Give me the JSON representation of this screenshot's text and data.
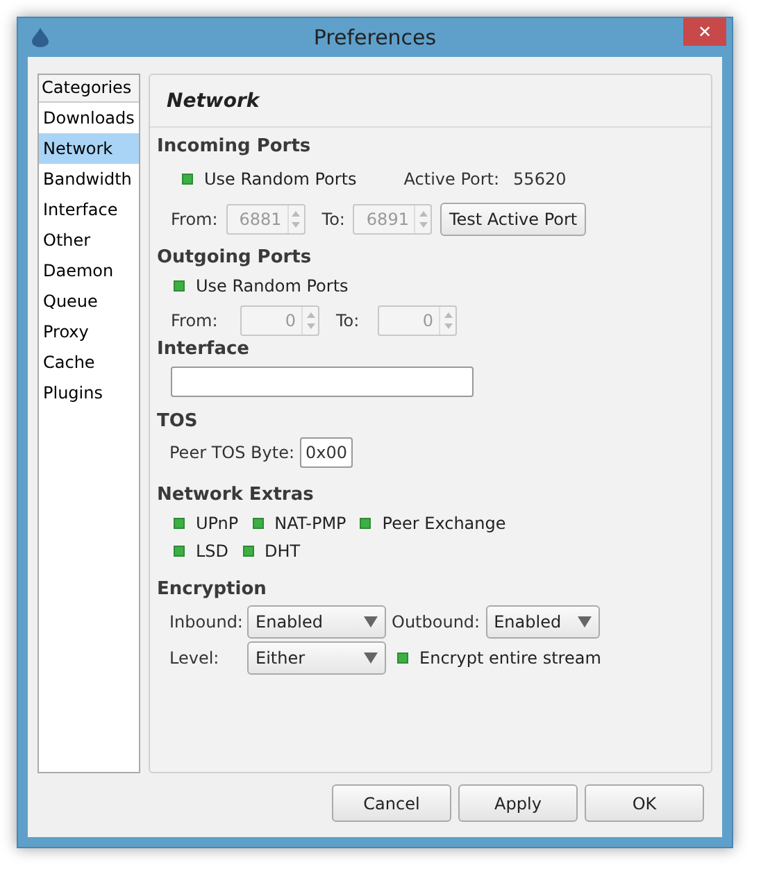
{
  "window": {
    "title": "Preferences",
    "close": "✕"
  },
  "sidebar": {
    "header": "Categories",
    "items": [
      {
        "label": "Downloads",
        "selected": false
      },
      {
        "label": "Network",
        "selected": true
      },
      {
        "label": "Bandwidth",
        "selected": false
      },
      {
        "label": "Interface",
        "selected": false
      },
      {
        "label": "Other",
        "selected": false
      },
      {
        "label": "Daemon",
        "selected": false
      },
      {
        "label": "Queue",
        "selected": false
      },
      {
        "label": "Proxy",
        "selected": false
      },
      {
        "label": "Cache",
        "selected": false
      },
      {
        "label": "Plugins",
        "selected": false
      }
    ]
  },
  "page_title": "Network",
  "incoming": {
    "heading": "Incoming Ports",
    "random": {
      "label": "Use Random Ports",
      "checked": true
    },
    "active_label": "Active Port:",
    "active_value": "55620",
    "from_label": "From:",
    "from_value": "6881",
    "to_label": "To:",
    "to_value": "6891",
    "test_button": "Test Active Port"
  },
  "outgoing": {
    "heading": "Outgoing Ports",
    "random": {
      "label": "Use Random Ports",
      "checked": true
    },
    "from_label": "From:",
    "from_value": "0",
    "to_label": "To:",
    "to_value": "0"
  },
  "interface": {
    "heading": "Interface"
  },
  "tos": {
    "heading": "TOS",
    "label": "Peer TOS Byte:",
    "value": "0x00"
  },
  "extras": {
    "heading": "Network Extras",
    "rows": [
      [
        {
          "label": "UPnP",
          "checked": true
        },
        {
          "label": "NAT-PMP",
          "checked": true
        },
        {
          "label": "Peer Exchange",
          "checked": true
        }
      ],
      [
        {
          "label": "LSD",
          "checked": true
        },
        {
          "label": "DHT",
          "checked": true
        }
      ]
    ]
  },
  "encryption": {
    "heading": "Encryption",
    "inbound_label": "Inbound:",
    "inbound": "Enabled",
    "outbound_label": "Outbound:",
    "outbound": "Enabled",
    "level_label": "Level:",
    "level": "Either",
    "stream": {
      "label": "Encrypt entire stream",
      "checked": true
    }
  },
  "buttons": [
    "Cancel",
    "Apply",
    "OK"
  ]
}
